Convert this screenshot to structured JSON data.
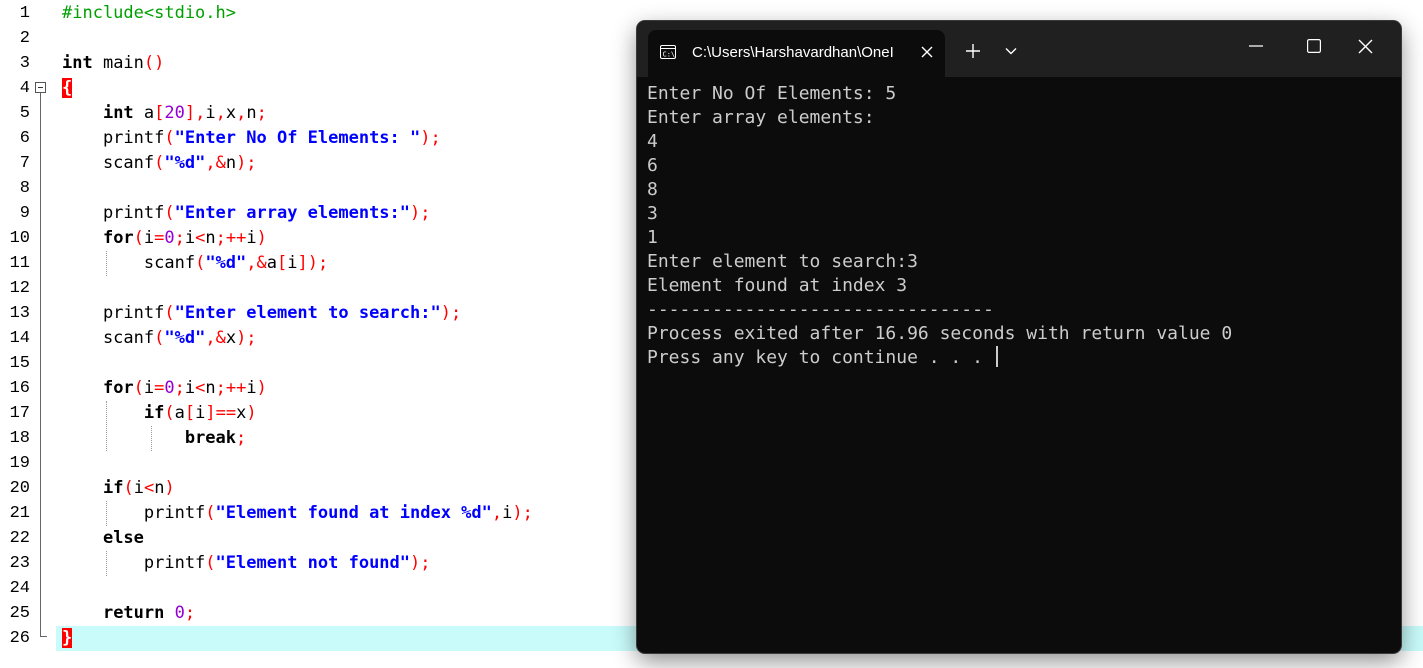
{
  "editor": {
    "line_numbers": [
      "1",
      "2",
      "3",
      "4",
      "5",
      "6",
      "7",
      "8",
      "9",
      "10",
      "11",
      "12",
      "13",
      "14",
      "15",
      "16",
      "17",
      "18",
      "19",
      "20",
      "21",
      "22",
      "23",
      "24",
      "25",
      "26"
    ],
    "lines": [
      [
        [
          "pp",
          "#include<stdio.h>"
        ]
      ],
      [],
      [
        [
          "kw",
          "int"
        ],
        [
          "t",
          " main"
        ],
        [
          "op",
          "()"
        ]
      ],
      [
        [
          "brace",
          "{"
        ]
      ],
      [
        [
          "t",
          "    "
        ],
        [
          "kw",
          "int"
        ],
        [
          "t",
          " a"
        ],
        [
          "op",
          "["
        ],
        [
          "num",
          "20"
        ],
        [
          "op",
          "],"
        ],
        [
          "t",
          "i"
        ],
        [
          "op",
          ","
        ],
        [
          "t",
          "x"
        ],
        [
          "op",
          ","
        ],
        [
          "t",
          "n"
        ],
        [
          "op",
          ";"
        ]
      ],
      [
        [
          "t",
          "    printf"
        ],
        [
          "op",
          "("
        ],
        [
          "str",
          "\"Enter No Of Elements: \""
        ],
        [
          "op",
          ");"
        ]
      ],
      [
        [
          "t",
          "    scanf"
        ],
        [
          "op",
          "("
        ],
        [
          "str",
          "\"%d\""
        ],
        [
          "op",
          ",&"
        ],
        [
          "t",
          "n"
        ],
        [
          "op",
          ");"
        ]
      ],
      [],
      [
        [
          "t",
          "    printf"
        ],
        [
          "op",
          "("
        ],
        [
          "str",
          "\"Enter array elements:\""
        ],
        [
          "op",
          ");"
        ]
      ],
      [
        [
          "t",
          "    "
        ],
        [
          "kw",
          "for"
        ],
        [
          "op",
          "("
        ],
        [
          "t",
          "i"
        ],
        [
          "op",
          "="
        ],
        [
          "num",
          "0"
        ],
        [
          "op",
          ";"
        ],
        [
          "t",
          "i"
        ],
        [
          "op",
          "<"
        ],
        [
          "t",
          "n"
        ],
        [
          "op",
          ";++"
        ],
        [
          "t",
          "i"
        ],
        [
          "op",
          ")"
        ]
      ],
      [
        [
          "t",
          "        scanf"
        ],
        [
          "op",
          "("
        ],
        [
          "str",
          "\"%d\""
        ],
        [
          "op",
          ",&"
        ],
        [
          "t",
          "a"
        ],
        [
          "op",
          "["
        ],
        [
          "t",
          "i"
        ],
        [
          "op",
          "]);"
        ]
      ],
      [],
      [
        [
          "t",
          "    printf"
        ],
        [
          "op",
          "("
        ],
        [
          "str",
          "\"Enter element to search:\""
        ],
        [
          "op",
          ");"
        ]
      ],
      [
        [
          "t",
          "    scanf"
        ],
        [
          "op",
          "("
        ],
        [
          "str",
          "\"%d\""
        ],
        [
          "op",
          ",&"
        ],
        [
          "t",
          "x"
        ],
        [
          "op",
          ");"
        ]
      ],
      [],
      [
        [
          "t",
          "    "
        ],
        [
          "kw",
          "for"
        ],
        [
          "op",
          "("
        ],
        [
          "t",
          "i"
        ],
        [
          "op",
          "="
        ],
        [
          "num",
          "0"
        ],
        [
          "op",
          ";"
        ],
        [
          "t",
          "i"
        ],
        [
          "op",
          "<"
        ],
        [
          "t",
          "n"
        ],
        [
          "op",
          ";++"
        ],
        [
          "t",
          "i"
        ],
        [
          "op",
          ")"
        ]
      ],
      [
        [
          "t",
          "        "
        ],
        [
          "kw",
          "if"
        ],
        [
          "op",
          "("
        ],
        [
          "t",
          "a"
        ],
        [
          "op",
          "["
        ],
        [
          "t",
          "i"
        ],
        [
          "op",
          "]=="
        ],
        [
          "t",
          "x"
        ],
        [
          "op",
          ")"
        ]
      ],
      [
        [
          "t",
          "            "
        ],
        [
          "kw",
          "break"
        ],
        [
          "op",
          ";"
        ]
      ],
      [],
      [
        [
          "t",
          "    "
        ],
        [
          "kw",
          "if"
        ],
        [
          "op",
          "("
        ],
        [
          "t",
          "i"
        ],
        [
          "op",
          "<"
        ],
        [
          "t",
          "n"
        ],
        [
          "op",
          ")"
        ]
      ],
      [
        [
          "t",
          "        printf"
        ],
        [
          "op",
          "("
        ],
        [
          "str",
          "\"Element found at index %d\""
        ],
        [
          "op",
          ","
        ],
        [
          "t",
          "i"
        ],
        [
          "op",
          ");"
        ]
      ],
      [
        [
          "t",
          "    "
        ],
        [
          "kw",
          "else"
        ]
      ],
      [
        [
          "t",
          "        printf"
        ],
        [
          "op",
          "("
        ],
        [
          "str",
          "\"Element not found\""
        ],
        [
          "op",
          ");"
        ]
      ],
      [],
      [
        [
          "t",
          "    "
        ],
        [
          "kw",
          "return"
        ],
        [
          "t",
          " "
        ],
        [
          "num",
          "0"
        ],
        [
          "op",
          ";"
        ]
      ],
      [
        [
          "brace",
          "}"
        ]
      ]
    ],
    "colors": {
      "keyword": "#000000",
      "string": "#0000ff",
      "operator": "#ff0000",
      "number": "#9400d3",
      "preprocessor": "#00a000",
      "current_line": "#c9fbfb"
    }
  },
  "terminal": {
    "tab_title": "C:\\Users\\Harshavardhan\\OneI",
    "icons": {
      "tab": "terminal-icon",
      "close_tab": "close-icon",
      "new_tab": "plus-icon",
      "dropdown": "chevron-down-icon",
      "minimize": "minimize-icon",
      "maximize": "maximize-icon",
      "close_window": "close-icon"
    },
    "output_lines": [
      "Enter No Of Elements: 5",
      "Enter array elements:",
      "4",
      "6",
      "8",
      "3",
      "1",
      "Enter element to search:3",
      "Element found at index 3",
      "--------------------------------",
      "Process exited after 16.96 seconds with return value 0",
      "Press any key to continue . . . "
    ],
    "colors": {
      "background": "#0c0c0c",
      "titlebar": "#202020",
      "text": "#cccccc"
    }
  }
}
